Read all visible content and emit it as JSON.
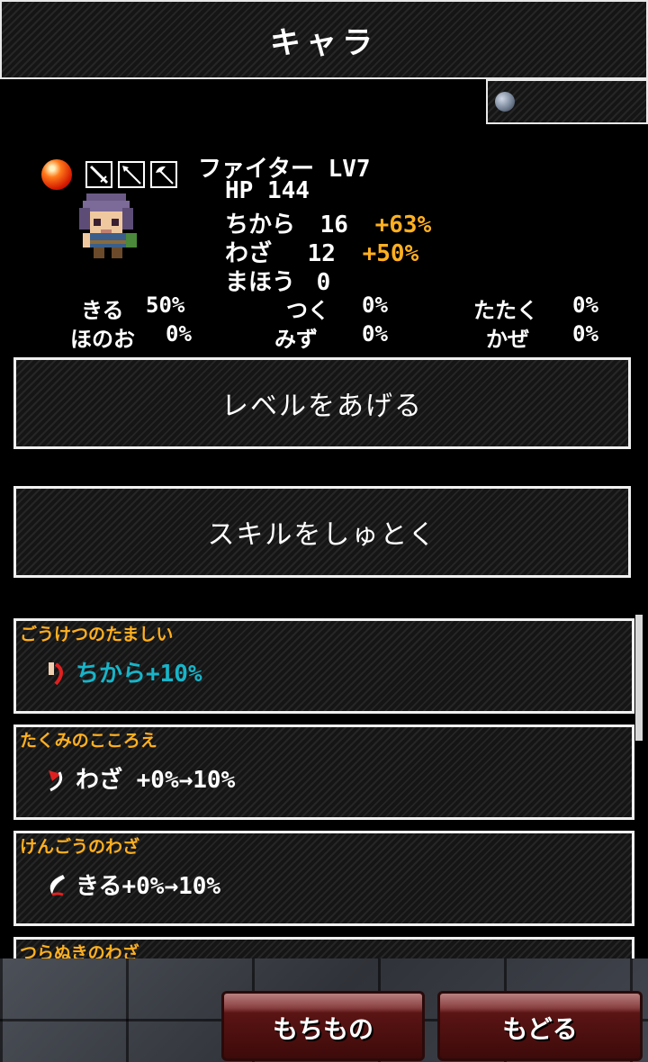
{
  "header": {
    "title": "キャラ"
  },
  "currency": {
    "icon": "gem-icon",
    "value": ""
  },
  "character": {
    "element_icon": "fire-orb-icon",
    "equipment_icons": [
      "sword-icon",
      "spear-icon",
      "axe-icon"
    ],
    "class_level": "ファイター LV7",
    "hp_line": "HP 144",
    "stats": [
      {
        "label": "ちから",
        "value": "16",
        "bonus": "+63%"
      },
      {
        "label": "わざ",
        "value": "12",
        "bonus": "+50%"
      },
      {
        "label": "まほう",
        "value": "0",
        "bonus": ""
      }
    ],
    "resistances": [
      {
        "label": "きる",
        "value": "50%"
      },
      {
        "label": "つく",
        "value": "0%"
      },
      {
        "label": "たたく",
        "value": "0%"
      },
      {
        "label": "ほのお",
        "value": "0%"
      },
      {
        "label": "みず",
        "value": "0%"
      },
      {
        "label": "かぜ",
        "value": "0%"
      }
    ]
  },
  "actions": {
    "level_up": "レベルをあげる",
    "learn_skill": "スキルをしゅとく"
  },
  "skills": [
    {
      "name": "ごうけつのたましい",
      "effect": "ちから+10%",
      "effect_color": "#18b4c8",
      "icon": "strength-icon"
    },
    {
      "name": "たくみのこころえ",
      "effect": "わざ +0%→10%",
      "effect_color": "#ffffff",
      "icon": "technique-icon"
    },
    {
      "name": "けんごうのわざ",
      "effect": "きる+0%→10%",
      "effect_color": "#ffffff",
      "icon": "slash-icon"
    },
    {
      "name": "つらぬきのわざ",
      "effect": "",
      "effect_color": "#ffffff",
      "icon": ""
    }
  ],
  "footer": {
    "items_button": "もちもの",
    "back_button": "もどる"
  }
}
